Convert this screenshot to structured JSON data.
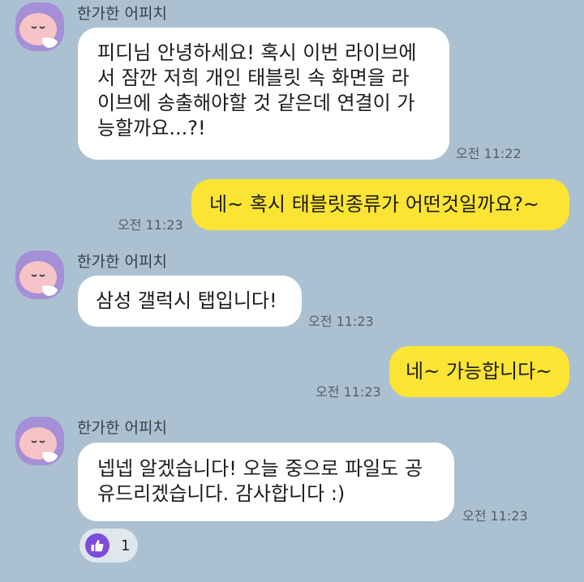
{
  "messages": [
    {
      "sender": "한가한 어피치",
      "type": "incoming",
      "lines": [
        "피디님 안녕하세요! 혹시 이번 라이브에",
        "서 잠깐 저희 개인 태블릿 속 화면을 라",
        "이브에 송출해야할 것 같은데 연결이 가",
        "능할까요...?!"
      ],
      "time": "오전 11:22"
    },
    {
      "type": "outgoing",
      "lines": [
        "네~ 혹시 태블릿종류가 어떤것일까요?~"
      ],
      "time": "오전 11:23"
    },
    {
      "sender": "한가한 어피치",
      "type": "incoming",
      "lines": [
        "삼성 갤럭시 탭입니다!"
      ],
      "time": "오전 11:23"
    },
    {
      "type": "outgoing",
      "lines": [
        "네~ 가능합니다~"
      ],
      "time": "오전 11:23"
    },
    {
      "sender": "한가한 어피치",
      "type": "incoming",
      "lines": [
        "넵넵 알겠습니다! 오늘 중으로 파일도 공",
        "유드리겠습니다. 감사합니다 :)"
      ],
      "time": "오전 11:23",
      "reaction": {
        "icon": "thumbs-up-icon",
        "count": "1"
      }
    }
  ],
  "colors": {
    "background": "#abc1d1",
    "incoming": "#ffffff",
    "outgoing": "#fbe433",
    "avatar": "#a58fd6",
    "reaction": "#7c4ddb"
  }
}
